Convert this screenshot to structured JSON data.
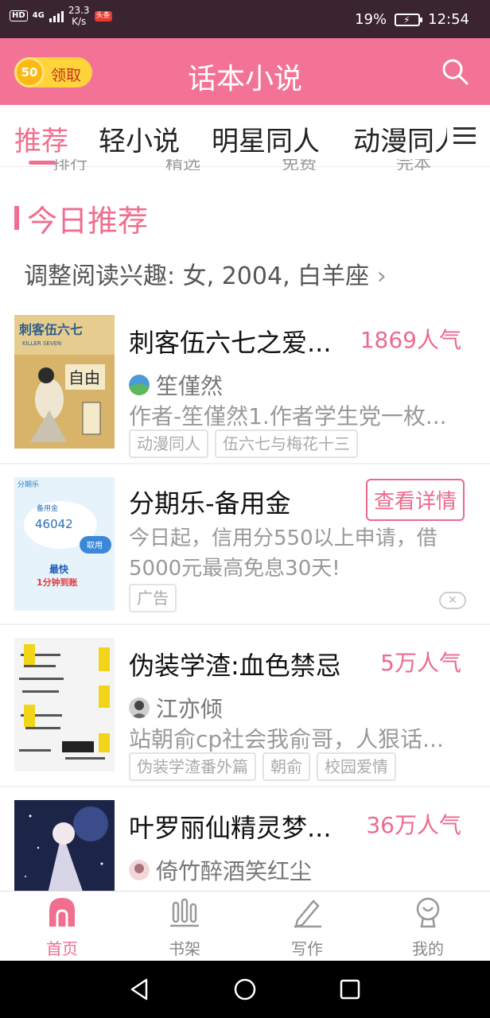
{
  "status_bar": {
    "hd": "HD",
    "network": "4G",
    "speed_value": "23.3",
    "speed_unit": "K/s",
    "news_app": "头条",
    "battery": "19%",
    "time": "12:54"
  },
  "header": {
    "coin_count": "50",
    "coin_action": "领取",
    "title": "话本小说",
    "icon": "search-icon"
  },
  "tabs": [
    {
      "label": "推荐",
      "active": true
    },
    {
      "label": "轻小说"
    },
    {
      "label": "明星同人"
    },
    {
      "label": "动漫同人"
    }
  ],
  "sub_tabs": [
    "排行",
    "精选",
    "免费",
    "完本"
  ],
  "section": {
    "title": "今日推荐",
    "interest": "调整阅读兴趣: 女, 2004, 白羊座",
    "interest_chevron": "›"
  },
  "books": [
    {
      "title": "刺客伍六七之爱...",
      "popularity": "1869人气",
      "author": "笙僅然",
      "desc": "作者-笙僅然1.作者学生党一枚...",
      "tags": [
        "动漫同人",
        "伍六七与梅花十三"
      ],
      "cover_title": "刺客伍六七",
      "cover_sub": "KILLER SEVEN",
      "cover_text": "自由"
    },
    {
      "title": "伪装学渣:血色禁忌",
      "popularity": "5万人气",
      "author": "江亦倾",
      "desc": "站朝俞cp社会我俞哥，人狠话...",
      "tags": [
        "伪装学渣番外篇",
        "朝俞",
        "校园爱情"
      ]
    },
    {
      "title": "叶罗丽仙精灵梦...",
      "popularity": "36万人气",
      "author": "倚竹醉酒笑红尘",
      "desc": "",
      "tags": []
    }
  ],
  "ad": {
    "title": "分期乐-备用金",
    "button": "查看详情",
    "desc": "今日起，信用分550以上申请，借5000元最高免息30天!",
    "tag": "广告",
    "close": "✕",
    "img_brand": "分期乐",
    "img_label": "备用金",
    "img_amount": "46042",
    "img_btn": "取用",
    "img_slogan1": "最快",
    "img_slogan2": "1分钟到账"
  },
  "bottom_nav": [
    {
      "label": "首页",
      "icon": "home-icon",
      "active": true
    },
    {
      "label": "书架",
      "icon": "bookshelf-icon"
    },
    {
      "label": "写作",
      "icon": "pen-icon"
    },
    {
      "label": "我的",
      "icon": "profile-icon"
    }
  ],
  "colors": {
    "accent": "#f06e8e",
    "header_bg": "#f37396",
    "status_bg": "#3a2430"
  }
}
